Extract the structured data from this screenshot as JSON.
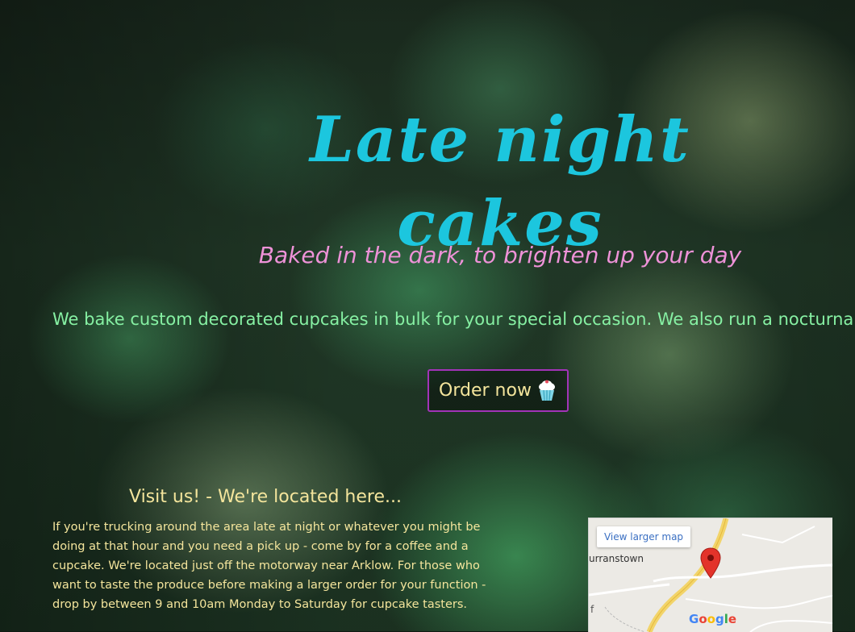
{
  "hero": {
    "title": "Late night cakes",
    "tagline": "Baked in the dark, to brighten up your day",
    "intro": "We bake custom decorated cupcakes in bulk for your special occasion. We also run a nocturna",
    "order_label": "Order now",
    "order_icon": "cupcake-icon"
  },
  "visit": {
    "heading": "Visit us! - We're located here...",
    "text": "If you're trucking around the area late at night or whatever you might be doing at that hour and you need a pick up - come by for a coffee and a cupcake. We're located just off the motorway near Arklow. For those who want to taste the produce before making a larger order for your function - drop by between 9 and 10am Monday to Saturday for cupcake tasters."
  },
  "map": {
    "larger_map_label": "View larger map",
    "place_label": "urranstown",
    "edge_label": "f",
    "logo_text": "Google",
    "pin_icon": "map-pin-icon"
  },
  "colors": {
    "title": "#1cc6de",
    "tagline": "#ee92d8",
    "intro": "#86f0a3",
    "accent_text": "#f4e59c",
    "button_border": "#a233b8"
  }
}
